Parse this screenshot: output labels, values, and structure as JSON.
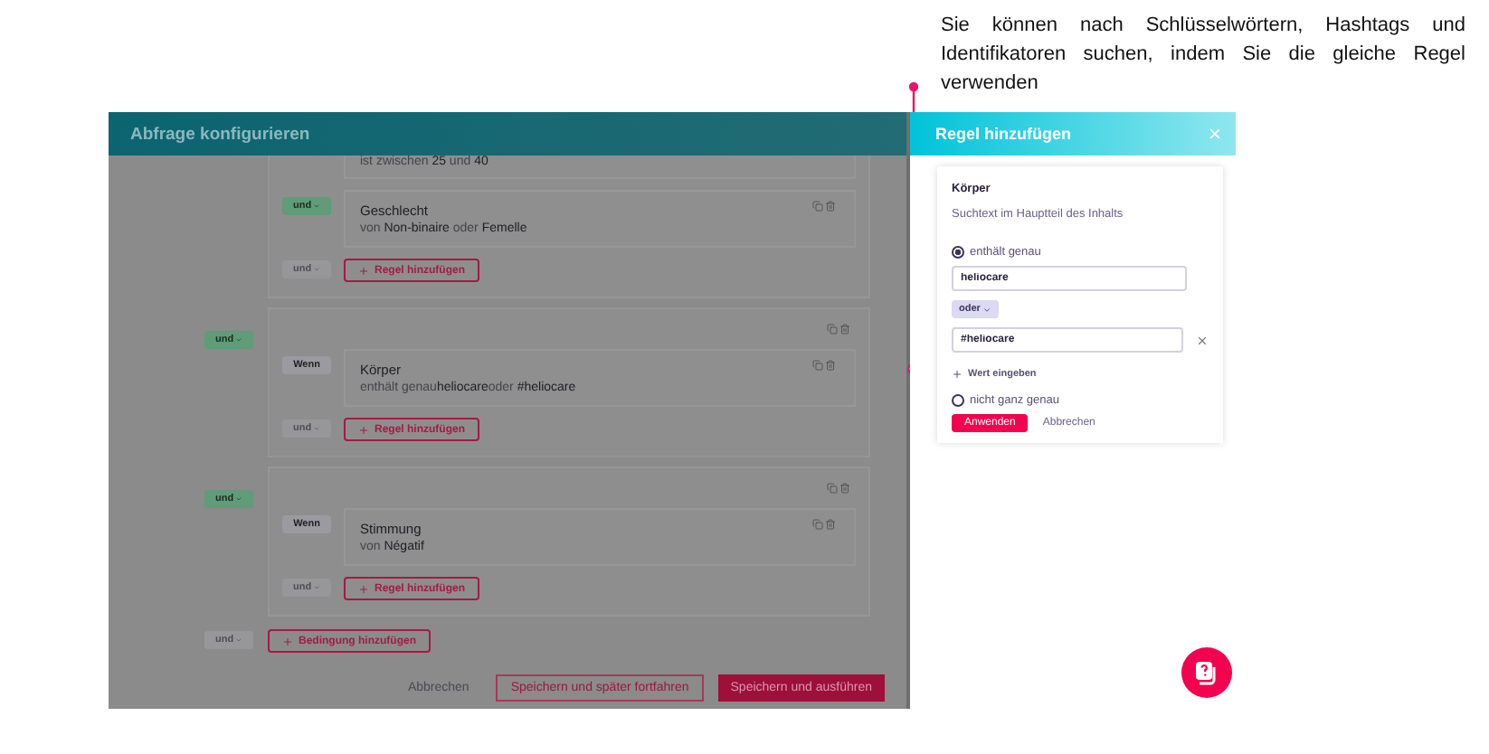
{
  "annotation": {
    "text": "Sie können nach Schlüsselwörtern, Hashtags und Identifikatoren suchen, indem Sie die gleiche Regel verwenden"
  },
  "query_dialog": {
    "title": "Abfrage konfigurieren",
    "groups": [
      {
        "clipped": true,
        "rules": [
          {
            "description": "ist zwischen **25** und **40**"
          },
          {
            "connector": {
              "kind": "operator",
              "label": "und",
              "active": true
            },
            "title": "Geschlecht",
            "description": "von **Non-binaire** oder **Femelle**"
          }
        ],
        "footer_connector": {
          "label": "und",
          "active": false
        },
        "add_rule": "Regel hinzufügen"
      },
      {
        "clipped": false,
        "connector": {
          "label": "und",
          "active": true
        },
        "rules": [
          {
            "connector": {
              "kind": "condition",
              "label": "Wenn"
            },
            "title": "Körper",
            "description": "enthält genau**heliocare**oder **#heliocare**"
          }
        ],
        "footer_connector": {
          "label": "und",
          "active": false
        },
        "add_rule": "Regel hinzufügen"
      },
      {
        "clipped": false,
        "connector": {
          "label": "und",
          "active": true
        },
        "rules": [
          {
            "connector": {
              "kind": "condition",
              "label": "Wenn"
            },
            "title": "Stimmung",
            "description": "von **Négatif**"
          }
        ],
        "footer_connector": {
          "label": "und",
          "active": false
        },
        "add_rule": "Regel hinzufügen"
      }
    ],
    "add_condition": {
      "connector": {
        "label": "und",
        "active": false
      },
      "label": "Bedingung hinzufügen"
    },
    "footer": {
      "cancel": "Abbrechen",
      "save_later": "Speichern und später fortfahren",
      "save_run": "Speichern und ausführen"
    }
  },
  "rule_panel": {
    "title": "Regel hinzufügen",
    "close": "×",
    "field": {
      "name": "Körper",
      "description": "Suchtext im Hauptteil des Inhalts"
    },
    "options": [
      {
        "label": "enthält genau",
        "selected": true,
        "values": [
          {
            "value": "heliocare",
            "removable": false
          },
          {
            "value": "#heliocare",
            "removable": true
          }
        ],
        "joiner": "oder",
        "add_value": "Wert eingeben"
      },
      {
        "label": "nicht ganz genau",
        "selected": false
      }
    ],
    "apply": "Anwenden",
    "cancel": "Abbrechen"
  }
}
